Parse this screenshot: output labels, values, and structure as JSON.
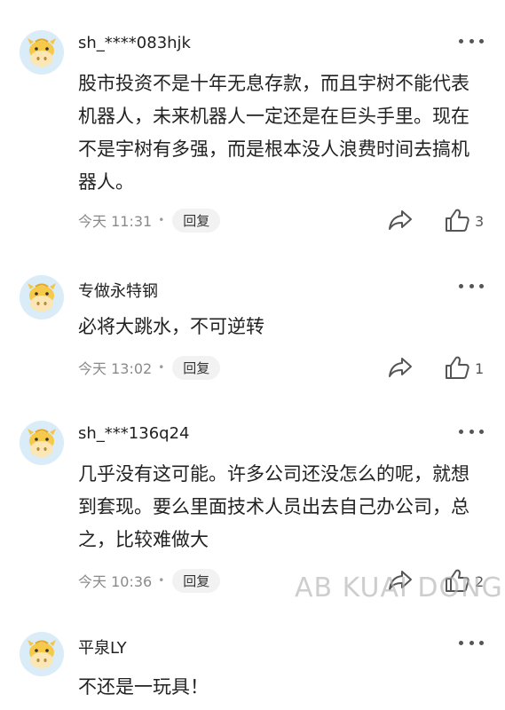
{
  "comments": [
    {
      "username": "sh_****083hjk",
      "text": "股市投资不是十年无息存款，而且宇树不能代表机器人，未来机器人一定还是在巨头手里。现在不是宇树有多强，而是根本没人浪费时间去搞机器人。",
      "time": "今天 11:31",
      "reply_label": "回复",
      "likes": "3"
    },
    {
      "username": "专做永特钢",
      "text": "必将大跳水，不可逆转",
      "time": "今天 13:02",
      "reply_label": "回复",
      "likes": "1"
    },
    {
      "username": "sh_***136q24",
      "text": "几乎没有这可能。许多公司还没怎么的呢，就想到套现。要么里面技术人员出去自己办公司，总之，比较难做大",
      "time": "今天 10:36",
      "reply_label": "回复",
      "likes": "2"
    },
    {
      "username": "平泉LY",
      "text": "不还是一玩具！"
    }
  ],
  "watermark": "AB KUAI DONG",
  "icons": {
    "avatar": "cow-avatar-icon",
    "more": "more-dots-icon",
    "share": "share-arrow-icon",
    "like": "thumbs-up-icon"
  }
}
